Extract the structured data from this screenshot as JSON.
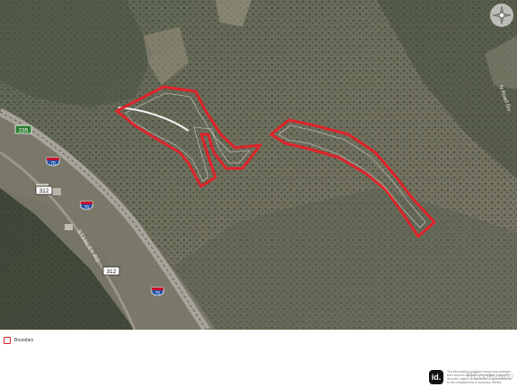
{
  "map": {
    "roads": {
      "hwy_235": "235",
      "hwy_312_a": "312",
      "hwy_312_b": "312",
      "i70_a": "70",
      "i70_b": "70",
      "i70_c": "70",
      "i70_d": "70",
      "stanley_rd": "STANLEY RD",
      "n_road": "N Road Gu"
    },
    "colors": {
      "boundary": "#e0232a",
      "terrain_dark": "#3d4637",
      "terrain_light": "#8a8a72"
    }
  },
  "footer": {
    "legend_label": "Boundary",
    "logo_text": "id.",
    "disclaimer": "The information contained herein was obtained from sources deemed to be reliable. Land id™ Services makes no warranties or guarantees as to the completeness or accuracy thereof.",
    "watermark": "REcolorado"
  }
}
